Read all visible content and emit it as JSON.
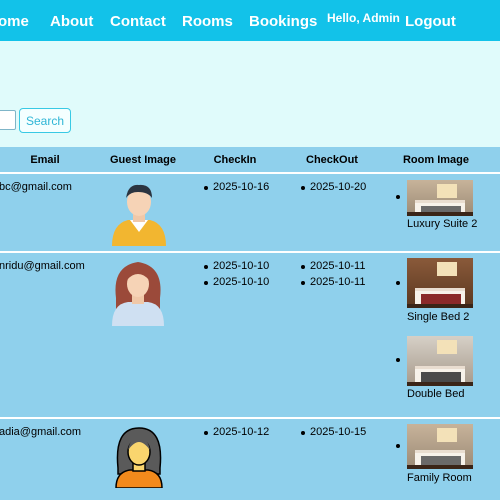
{
  "nav": {
    "home": "ome",
    "about": "About",
    "contact": "Contact",
    "rooms": "Rooms",
    "bookings": "Bookings",
    "greeting": "Hello, Admin",
    "logout": "Logout"
  },
  "search": {
    "button_label": "Search",
    "input_value": ""
  },
  "table": {
    "headers": [
      "Email",
      "Guest Image",
      "CheckIn",
      "CheckOut",
      "Room Image"
    ],
    "rows": [
      {
        "email": "bc@gmail.com",
        "checkins": [
          "2025-10-16"
        ],
        "checkouts": [
          "2025-10-20"
        ],
        "rooms": [
          "Luxury Suite 2"
        ]
      },
      {
        "email": "nridu@gmail.com",
        "checkins": [
          "2025-10-10",
          "2025-10-10"
        ],
        "checkouts": [
          "2025-10-11",
          "2025-10-11"
        ],
        "rooms": [
          "Single Bed 2",
          "Double Bed"
        ]
      },
      {
        "email": "adia@gmail.com",
        "checkins": [
          "2025-10-12"
        ],
        "checkouts": [
          "2025-10-15"
        ],
        "rooms": [
          "Family Room"
        ]
      }
    ]
  },
  "colors": {
    "navbar": "#12c2e9",
    "page_background": "#e0fbfb",
    "table_background": "#8fd0ec"
  }
}
